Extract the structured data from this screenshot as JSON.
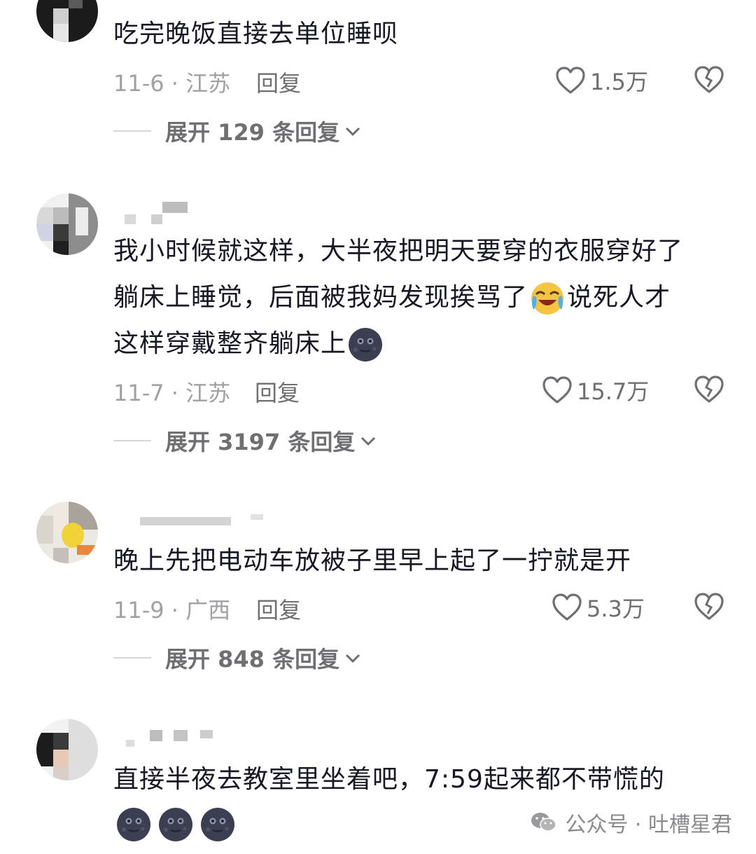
{
  "comments": [
    {
      "username": "",
      "text": "吃完晚饭直接去单位睡呗",
      "date": "11-6",
      "location": "江苏",
      "reply_label": "回复",
      "likes": "1.5万",
      "expand_label": "展开 129 条回复"
    },
    {
      "username": "",
      "text_line1": "我小时候就这样，大半夜把明天要穿的衣服穿好了",
      "text_line2a": "躺床上睡觉，后面被我妈发现挨骂了",
      "text_line2b": "说死人才",
      "text_line3": "这样穿戴整齐躺床上",
      "date": "11-7",
      "location": "江苏",
      "reply_label": "回复",
      "likes": "15.7万",
      "expand_label": "展开 3197 条回复"
    },
    {
      "username": "",
      "text": "晚上先把电动车放被子里早上起了一拧就是开",
      "date": "11-9",
      "location": "广西",
      "reply_label": "回复",
      "likes": "5.3万",
      "expand_label": "展开 848 条回复"
    },
    {
      "username": "",
      "text": "直接半夜去教室里坐着吧，7:59起来都不带慌的",
      "emojis": [
        "new-moon-face",
        "new-moon-face",
        "new-moon-face"
      ]
    }
  ],
  "watermark": {
    "source": "公众号 · 吐槽星君",
    "icon": "wechat-icon"
  },
  "colors": {
    "text": "#161823",
    "meta": "#a0a0a5",
    "action": "#6e6e73"
  }
}
